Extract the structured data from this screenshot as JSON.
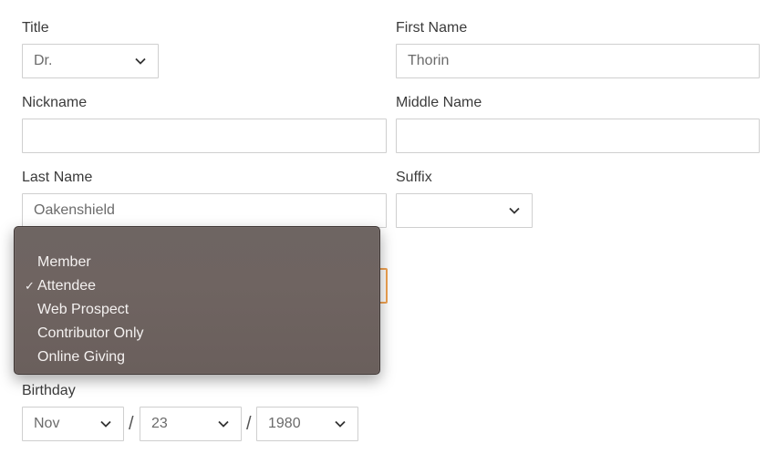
{
  "form": {
    "title_label": "Title",
    "title_value": "Dr.",
    "first_name_label": "First Name",
    "first_name_value": "Thorin",
    "nickname_label": "Nickname",
    "nickname_value": "",
    "middle_name_label": "Middle Name",
    "middle_name_value": "",
    "last_name_label": "Last Name",
    "last_name_value": "Oakenshield",
    "suffix_label": "Suffix",
    "suffix_value": "",
    "birthday_label": "Birthday",
    "birthday_month": "Nov",
    "birthday_day": "23",
    "birthday_year": "1980",
    "date_separator": "/"
  },
  "dropdown": {
    "items": [
      {
        "label": "Member",
        "checked": false
      },
      {
        "label": "Attendee",
        "checked": true
      },
      {
        "label": "Web Prospect",
        "checked": false
      },
      {
        "label": "Contributor Only",
        "checked": false
      },
      {
        "label": "Online Giving",
        "checked": false
      }
    ],
    "check_glyph": "✓"
  },
  "colors": {
    "focus_border": "#f0a353",
    "menu_bg": "#6e6562",
    "menu_text": "#f4f1f0"
  }
}
